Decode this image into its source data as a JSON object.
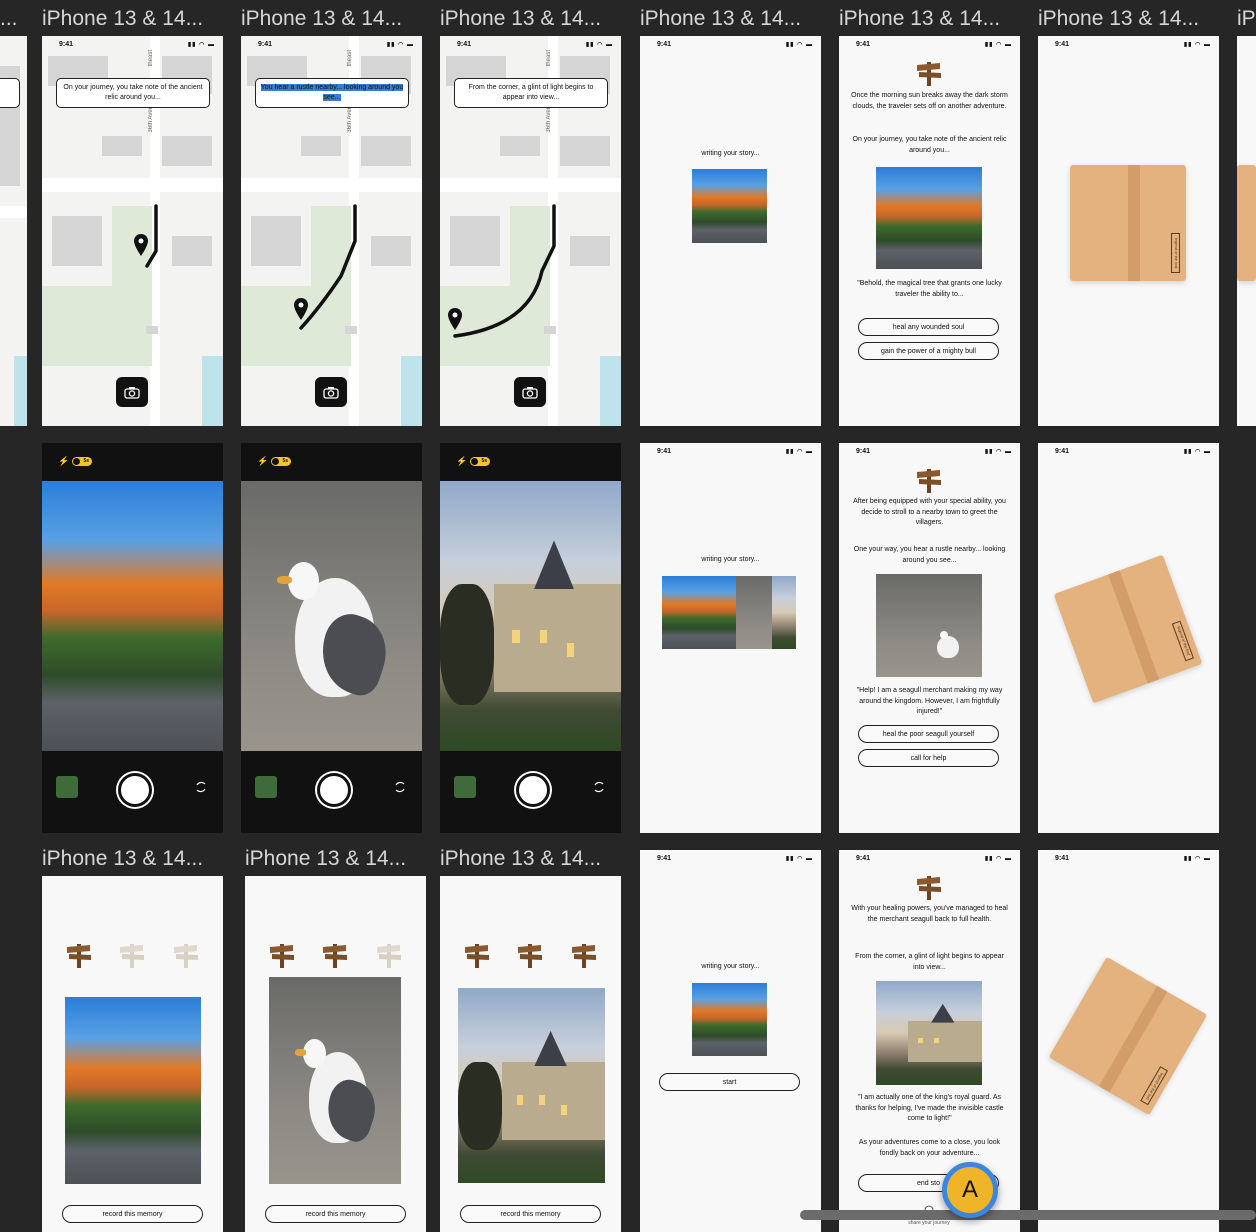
{
  "labels": {
    "frame": "iPhone 13 & 14...",
    "frame_edge_left": "...",
    "frame_edge_right": "iP"
  },
  "status": {
    "time": "9:41",
    "icons": "▮▮ ◠ ▬"
  },
  "map_screens": [
    {
      "text": "On your journey, you take note of the ancient relic around you..."
    },
    {
      "text": "You hear a rustle nearby... looking around you see..."
    },
    {
      "text": "From the corner, a glint of light begins to appear into view..."
    }
  ],
  "map_street": "36th Aven",
  "map_street_top": "theast",
  "camera": {
    "toggle_label": "5s",
    "flash_icon": "⚡"
  },
  "memory": {
    "button": "record this memory"
  },
  "writing": {
    "text": "writing your story...",
    "start": "start"
  },
  "story1": {
    "p1": "Once the morning sun breaks away the dark storm clouds, the traveler sets off on another adventure.",
    "p2": "On your journey, you take note of the ancient relic around you...",
    "quote": "\"Behold, the magical tree that grants one lucky traveler the ability to...",
    "opt1": "heal any wounded soul",
    "opt2": "gain the power of a mighty bull"
  },
  "story2": {
    "p1": "After being equipped with your special ability, you decide to stroll to a nearby town to greet the villagers.",
    "p2": "One your way, you hear a rustle nearby... looking around you see...",
    "quote": "\"Help! I am a seagull merchant making my way around the kingdom. However, I am frightfully injured!\"",
    "opt1": "heal the poor seagull yourself",
    "opt2": "call for help"
  },
  "story3": {
    "p1": "With your healing powers, you've managed to heal the merchant seagull back to full health.",
    "p2": "From the corner, a glint of light begins to appear into view...",
    "quote": "\"I am actually one of the king's royal guard. As thanks for helping, I've made the invisible castle come to light!\"",
    "p3": "As your adventures come to a close, you look fondly back on your adventure...",
    "end": "end sto",
    "share": "share your journey"
  },
  "book": {
    "label": "legend of the lost relic"
  },
  "fab": {
    "letter": "A"
  },
  "colors": {
    "bg": "#262626",
    "accent": "#3a86e0",
    "fab": "#f0b429",
    "book": "#e3b27e"
  }
}
